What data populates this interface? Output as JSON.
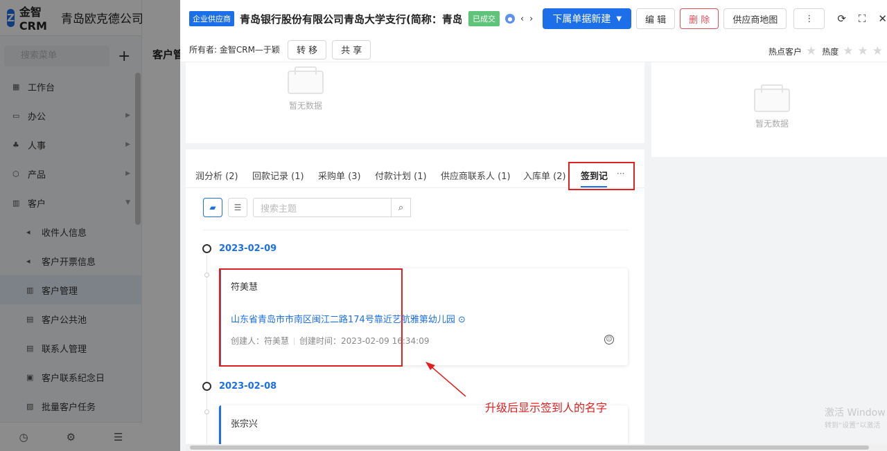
{
  "app": {
    "logo_text": "金智CRM",
    "company": "青岛欧克德公司",
    "search_placeholder": "搜索菜单",
    "add_icon": "+"
  },
  "sidebar": {
    "items": [
      {
        "label": "工作台",
        "icon": "dashboard-icon"
      },
      {
        "label": "办公",
        "icon": "office-icon"
      },
      {
        "label": "人事",
        "icon": "hr-icon"
      },
      {
        "label": "产品",
        "icon": "product-icon"
      },
      {
        "label": "客户",
        "icon": "customer-icon"
      }
    ],
    "sub_items": [
      {
        "label": "收件人信息"
      },
      {
        "label": "客户开票信息"
      },
      {
        "label": "客户管理"
      },
      {
        "label": "客户公共池"
      },
      {
        "label": "联系人管理"
      },
      {
        "label": "客户联系纪念日"
      },
      {
        "label": "批量客户任务"
      }
    ]
  },
  "background": {
    "title": "客户管"
  },
  "header": {
    "type_tag": "企业供应商",
    "title": "青岛银行股份有限公司青岛大学支行(简称：青岛...",
    "status_tag": "已成交",
    "new_button": "下属单据新建",
    "edit_button": "编 辑",
    "delete_button": "删 除",
    "map_button": "供应商地图",
    "more": "⋮"
  },
  "subheader": {
    "owner": "所有者: 金智CRM—于颖",
    "transfer_button": "转 移",
    "share_button": "共 享",
    "hot_label": "热点客户",
    "heat_label": "热度"
  },
  "empty_text": "暂无数据",
  "tabs": [
    {
      "label": "润分析 (2)"
    },
    {
      "label": "回款记录 (1)"
    },
    {
      "label": "采购单 (3)"
    },
    {
      "label": "付款计划 (1)"
    },
    {
      "label": "供应商联系人 (1)"
    },
    {
      "label": "入库单 (2)"
    },
    {
      "label": "签到记"
    }
  ],
  "tab_more": "···",
  "search": {
    "placeholder": "搜索主题"
  },
  "records": [
    {
      "date": "2023-02-09",
      "name": "符美慧",
      "address": "山东省青岛市市南区闽江二路174号靠近艺航雅第幼儿园",
      "creator": "创建人：符美慧",
      "created_time": "创建时间：2023-02-09 16:34:09"
    },
    {
      "date": "2023-02-08",
      "name": "张宗兴"
    }
  ],
  "annotation": "升级后显示签到人的名字",
  "watermark": {
    "line1": "激活 Window",
    "line2": "转到“设置”以激活 "
  }
}
